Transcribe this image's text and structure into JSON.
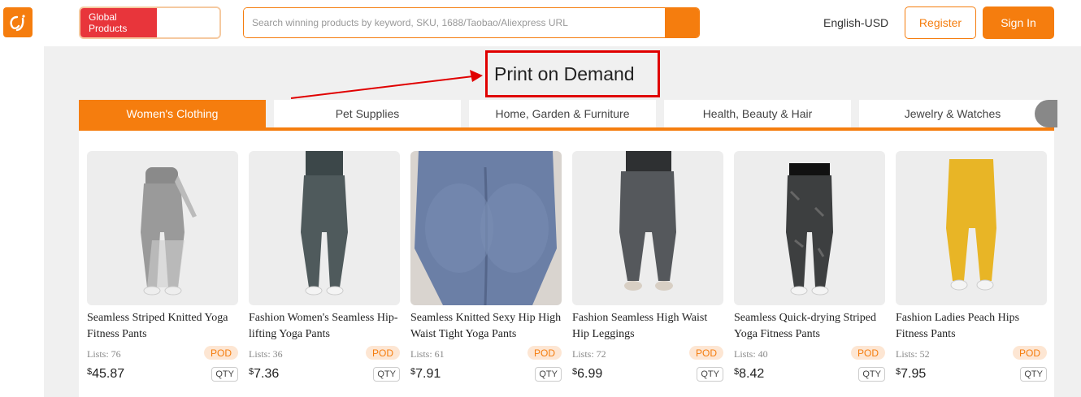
{
  "header": {
    "global_label": "Global Products",
    "search_placeholder": "Search winning products by keyword, SKU, 1688/Taobao/Aliexpress URL",
    "language": "English-USD",
    "register_label": "Register",
    "signin_label": "Sign In"
  },
  "section": {
    "title": "Print on Demand"
  },
  "tabs": [
    {
      "label": "Women's Clothing",
      "active": true
    },
    {
      "label": "Pet Supplies",
      "active": false
    },
    {
      "label": "Home, Garden & Furniture",
      "active": false
    },
    {
      "label": "Health, Beauty & Hair",
      "active": false
    },
    {
      "label": "Jewelry & Watches",
      "active": false
    }
  ],
  "products": [
    {
      "name": "Seamless Striped Knitted Yoga Fitness Pants",
      "lists": "Lists: 76",
      "badge": "POD",
      "currency": "$",
      "price": "45.87",
      "qty": "QTY",
      "color": "#9a9a9a"
    },
    {
      "name": "Fashion Women's Seamless Hip-lifting Yoga Pants",
      "lists": "Lists: 36",
      "badge": "POD",
      "currency": "$",
      "price": "7.36",
      "qty": "QTY",
      "color": "#4f5a5c"
    },
    {
      "name": "Seamless Knitted Sexy Hip High Waist Tight Yoga Pants",
      "lists": "Lists: 61",
      "badge": "POD",
      "currency": "$",
      "price": "7.91",
      "qty": "QTY",
      "color": "#6b7fa6"
    },
    {
      "name": "Fashion Seamless High Waist Hip Leggings",
      "lists": "Lists: 72",
      "badge": "POD",
      "currency": "$",
      "price": "6.99",
      "qty": "QTY",
      "color": "#55585c"
    },
    {
      "name": "Seamless Quick-drying Striped Yoga Fitness Pants",
      "lists": "Lists: 40",
      "badge": "POD",
      "currency": "$",
      "price": "8.42",
      "qty": "QTY",
      "color": "#3d3f40"
    },
    {
      "name": "Fashion Ladies Peach Hips Fitness Pants",
      "lists": "Lists: 52",
      "badge": "POD",
      "currency": "$",
      "price": "7.95",
      "qty": "QTY",
      "color": "#e8b526"
    }
  ],
  "colors": {
    "brand_orange": "#f57d0e",
    "annotation_red": "#e00000",
    "global_red": "#e8353b"
  },
  "icons": {
    "logo": "cj-logo-icon",
    "search_button": "search-button"
  }
}
